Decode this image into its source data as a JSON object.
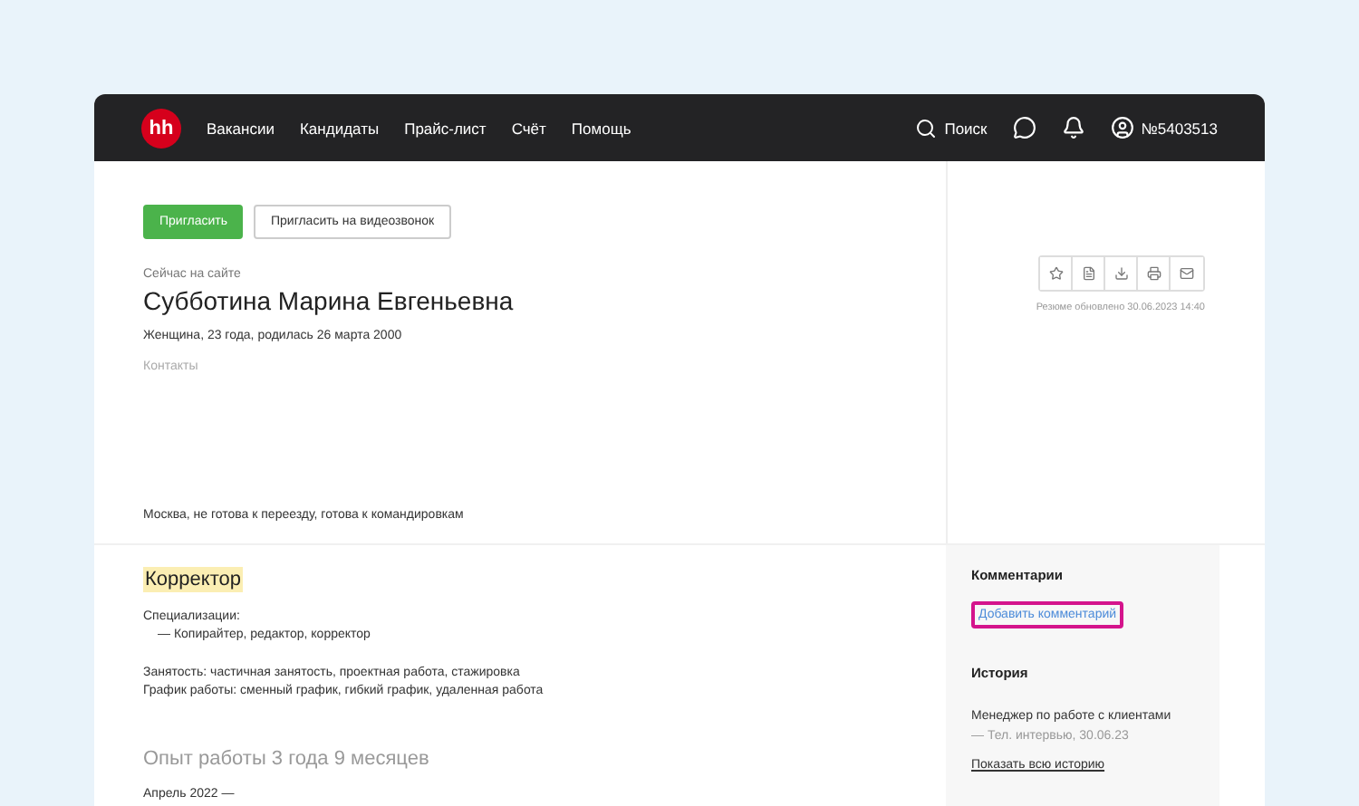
{
  "header": {
    "logo": "hh",
    "nav": [
      "Вакансии",
      "Кандидаты",
      "Прайс-лист",
      "Счёт",
      "Помощь"
    ],
    "search": "Поиск",
    "account": "№5403513"
  },
  "actions": [
    {
      "label": "Пригласить",
      "kind": "primary"
    },
    {
      "label": "Пригласить на видеозвонок",
      "kind": "secondary"
    }
  ],
  "profile": {
    "status": "Сейчас на сайте",
    "name": "Субботина Марина Евгеньевна",
    "info": "Женщина, 23 года, родилась 26 марта 2000",
    "contacts_label": "Контакты",
    "location": "Москва, не готова к переезду, готова к командировкам"
  },
  "resume_tools": {
    "updated": "Резюме обновлено 30.06.2023 14:40"
  },
  "position": {
    "title": "Корректор",
    "highlighted": true,
    "specializations_label": "Специализации:",
    "specializations": "— Копирайтер, редактор, корректор",
    "employment": "Занятость: частичная занятость, проектная работа, стажировка",
    "schedule": "График работы: сменный график, гибкий график, удаленная работа"
  },
  "experience": {
    "title": "Опыт работы 3 года 9 месяцев",
    "period": "Апрель 2022 —"
  },
  "comments": {
    "title": "Комментарии",
    "add_link": "Добавить комментарий",
    "highlighted": true
  },
  "history": {
    "title": "История",
    "entry": "Менеджер по работе с клиентами",
    "entry_detail": "— Тел. интервью, 30.06.23",
    "show_all": "Показать всю историю"
  }
}
